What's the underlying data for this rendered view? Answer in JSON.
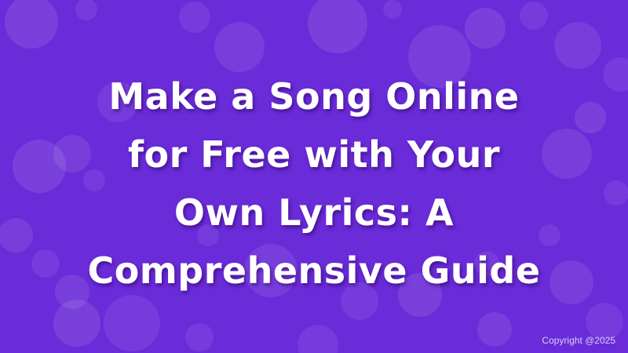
{
  "banner": {
    "background_color": "#6a2bd9",
    "title_lines": [
      "Make a Song Online",
      "for Free with Your",
      "Own Lyrics: A",
      "Comprehensive Guide"
    ],
    "copyright": "Copyright @2025"
  }
}
